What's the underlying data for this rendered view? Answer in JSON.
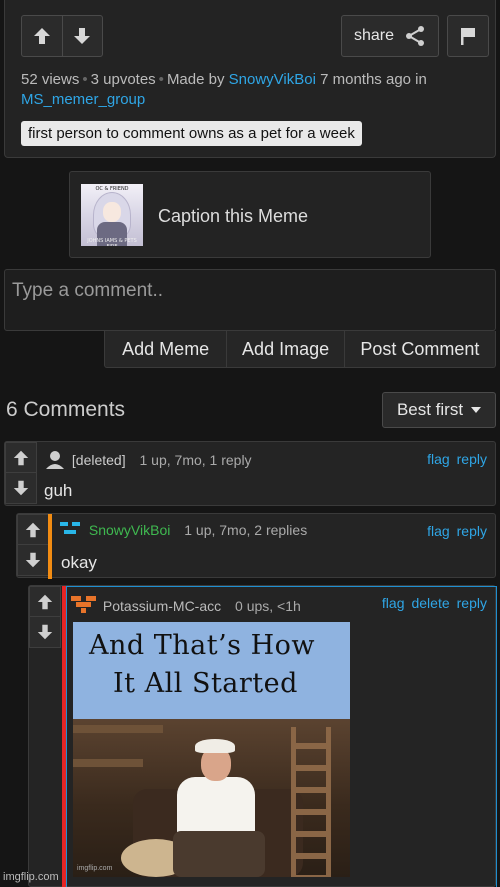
{
  "post": {
    "share_label": "share",
    "views": "52 views",
    "upvotes": "3 upvotes",
    "made_by_prefix": "Made by",
    "author": "SnowyVikBoi",
    "time_prefix": "7 months ago in",
    "stream": "MS_memer_group",
    "tag": "first person to comment owns as a pet for a week"
  },
  "caption": {
    "label": "Caption this Meme",
    "thumb_top": "OC & FRIEND",
    "thumb_bottom": "JOHNS IAMS & PETS FIRE"
  },
  "composer": {
    "placeholder": "Type a comment..",
    "add_meme": "Add Meme",
    "add_image": "Add Image",
    "post_comment": "Post Comment"
  },
  "comments_header": {
    "count": "6 Comments",
    "sort": "Best first"
  },
  "comments": [
    {
      "user": "[deleted]",
      "meta": "1 up, 7mo, 1 reply",
      "text": "guh",
      "actions": [
        "flag",
        "reply"
      ],
      "user_color": "#cccccc"
    },
    {
      "user": "SnowyVikBoi",
      "meta": "1 up, 7mo, 2 replies",
      "text": "okay",
      "actions": [
        "flag",
        "reply"
      ],
      "user_color": "#3fb950"
    },
    {
      "user": "Potassium-MC-acc",
      "meta": "0 ups, <1h",
      "text": "",
      "actions": [
        "flag",
        "delete",
        "reply"
      ],
      "user_color": "#bbbbbb"
    }
  ],
  "meme_image": {
    "line1": "And That’s How",
    "line2": "It All Started",
    "watermark": "imgflip.com"
  },
  "footer": {
    "watermark": "imgflip.com"
  },
  "colors": {
    "link": "#2fa6e6",
    "reply_bar_2": "#f28c13",
    "reply_bar_3": "#e52525",
    "highlight_border": "#1f8fd0"
  }
}
